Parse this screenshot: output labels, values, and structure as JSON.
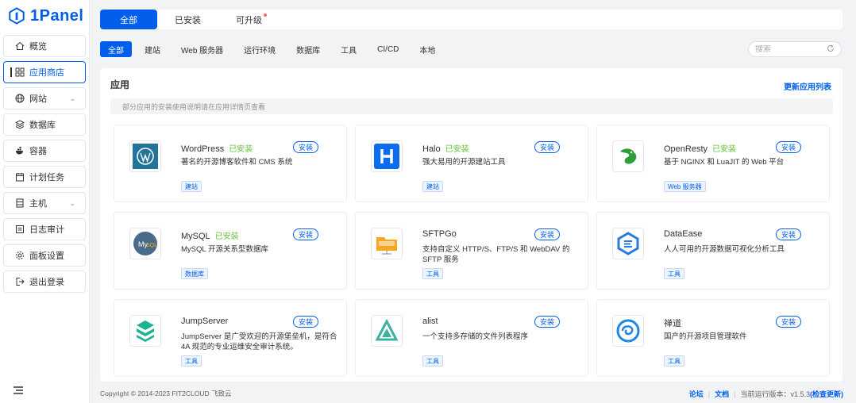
{
  "brand": {
    "name": "1Panel",
    "color": "#005eeb"
  },
  "sidebar": {
    "items": [
      {
        "label": "概览",
        "icon": "home-icon",
        "chevron": false
      },
      {
        "label": "应用商店",
        "icon": "grid-icon",
        "chevron": false,
        "active": true
      },
      {
        "label": "网站",
        "icon": "globe-icon",
        "chevron": true
      },
      {
        "label": "数据库",
        "icon": "database-icon",
        "chevron": false
      },
      {
        "label": "容器",
        "icon": "docker-icon",
        "chevron": false
      },
      {
        "label": "计划任务",
        "icon": "calendar-icon",
        "chevron": false
      },
      {
        "label": "主机",
        "icon": "server-icon",
        "chevron": true
      },
      {
        "label": "日志审计",
        "icon": "log-icon",
        "chevron": false
      },
      {
        "label": "面板设置",
        "icon": "gear-icon",
        "chevron": false
      },
      {
        "label": "退出登录",
        "icon": "logout-icon",
        "chevron": false
      }
    ]
  },
  "top_tabs": [
    {
      "label": "全部",
      "active": true
    },
    {
      "label": "已安装",
      "active": false
    },
    {
      "label": "可升级",
      "active": false,
      "dot": true
    }
  ],
  "filters": [
    "全部",
    "建站",
    "Web 服务器",
    "运行环境",
    "数据库",
    "工具",
    "CI/CD",
    "本地"
  ],
  "search": {
    "placeholder": "搜索",
    "value": ""
  },
  "panel": {
    "title": "应用",
    "link": "更新应用列表",
    "notice": "部分应用的安装使用说明请在应用详情页查看"
  },
  "apps": [
    {
      "name": "WordPress",
      "installed": "已安装",
      "button": "安装",
      "desc": "著名的开源博客软件和 CMS 系统",
      "tag": "建站",
      "icon": "wordpress-icon"
    },
    {
      "name": "Halo",
      "installed": "已安装",
      "button": "安装",
      "desc": "强大易用的开源建站工具",
      "tag": "建站",
      "icon": "halo-icon"
    },
    {
      "name": "OpenResty",
      "installed": "已安装",
      "button": "安装",
      "desc": "基于 NGINX 和 LuaJIT 的 Web 平台",
      "tag": "Web 服务器",
      "icon": "openresty-icon"
    },
    {
      "name": "MySQL",
      "installed": "已安装",
      "button": "安装",
      "desc": "MySQL 开源关系型数据库",
      "tag": "数据库",
      "icon": "mysql-icon"
    },
    {
      "name": "SFTPGo",
      "installed": "",
      "button": "安装",
      "desc": "支持自定义 HTTP/S、FTP/S 和 WebDAV 的 SFTP 服务",
      "tag": "工具",
      "icon": "sftpgo-icon"
    },
    {
      "name": "DataEase",
      "installed": "",
      "button": "安装",
      "desc": "人人可用的开源数据可视化分析工具",
      "tag": "工具",
      "icon": "dataease-icon"
    },
    {
      "name": "JumpServer",
      "installed": "",
      "button": "安装",
      "desc": "JumpServer 是广受欢迎的开源堡垒机，是符合 4A 规范的专业运维安全审计系统。",
      "tag": "工具",
      "icon": "jumpserver-icon"
    },
    {
      "name": "alist",
      "installed": "",
      "button": "安装",
      "desc": "一个支持多存储的文件列表程序",
      "tag": "工具",
      "icon": "alist-icon"
    },
    {
      "name": "禅道",
      "installed": "",
      "button": "安装",
      "desc": "国产的开源项目管理软件",
      "tag": "工具",
      "icon": "zentao-icon"
    }
  ],
  "footer": {
    "copyright": "Copyright © 2014-2023 FIT2CLOUD 飞致云",
    "forum": "论坛",
    "docs": "文档",
    "version_label": "当前运行版本：",
    "version": "v1.5.3",
    "check_update": "(检查更新)"
  }
}
